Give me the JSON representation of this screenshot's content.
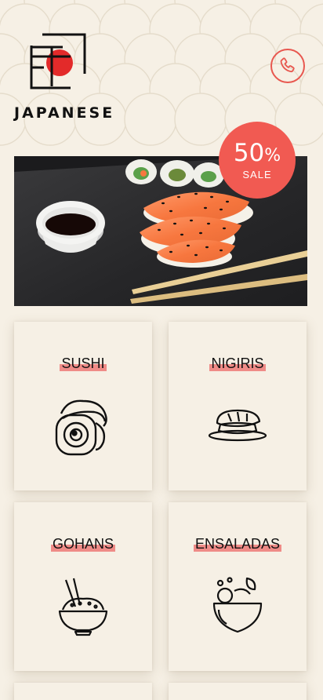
{
  "header": {
    "brand": "JAPANESE",
    "logo_icon": "chopsticks-sun-logo",
    "phone_icon": "phone-icon",
    "accent_color": "#e8574f"
  },
  "promo": {
    "percent": "50",
    "percent_sign": "%",
    "label": "SALE",
    "badge_color": "#f15a52",
    "image_subject": "sushi-rolls-nigiri-soy-sauce-chopsticks"
  },
  "categories": [
    {
      "label": "SUSHI",
      "icon": "sushi-roll-icon"
    },
    {
      "label": "NIGIRIS",
      "icon": "nigiri-icon"
    },
    {
      "label": "GOHANS",
      "icon": "rice-bowl-icon"
    },
    {
      "label": "ENSALADAS",
      "icon": "salad-bowl-icon"
    }
  ]
}
